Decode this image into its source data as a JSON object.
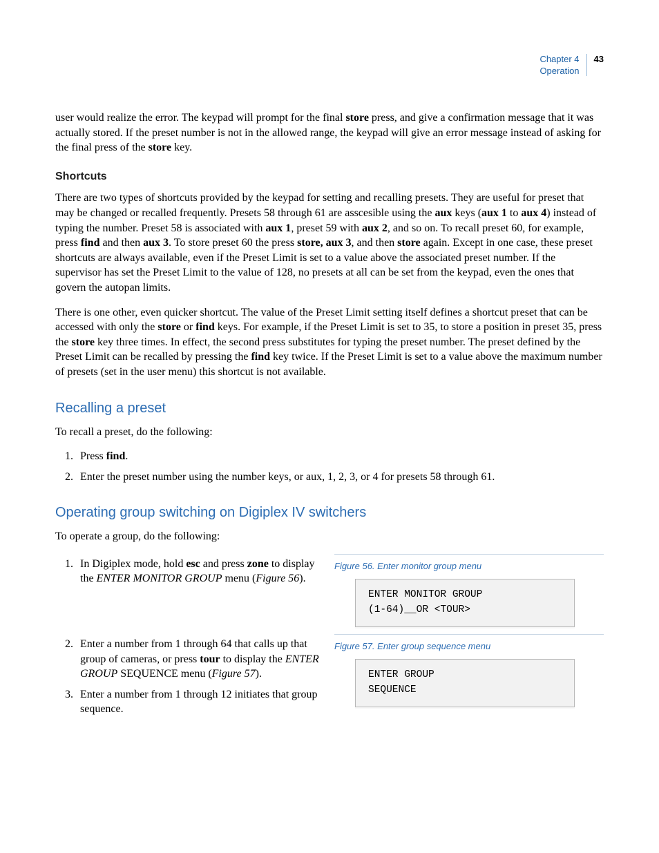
{
  "header": {
    "chapter": "Chapter 4",
    "section": "Operation",
    "page": "43"
  },
  "intro_para": "user would realize the error. The keypad will prompt for the final <b>store</b> press, and give a confirmation message that it was actually stored. If the preset number is not in the allowed range, the keypad will give an error message instead of asking for the final press of the <b>store</b> key.",
  "shortcuts": {
    "heading": "Shortcuts",
    "p1": "There are two types of shortcuts provided by the keypad for setting and recalling presets. They are useful for preset that may be changed or recalled frequently. Presets 58 through 61 are asscesible using the <b>aux</b> keys (<b>aux 1</b> to <b>aux 4</b>) instead of  typing the number. Preset 58 is associated with <b>aux 1</b>, preset 59 with <b>aux 2</b>, and so on. To recall preset 60, for example, press <b>find</b> and then <b>aux 3</b>. To store preset 60 the press <b>store, aux 3</b>, and then <b>store</b> again. Except in one case, these preset shortcuts are always available, even if the Preset Limit is set to a value above the associated preset number. If the supervisor has set the Preset Limit to the value of 128, no presets at all can be set from the keypad, even the ones that govern the autopan limits.",
    "p2": "There is one other, even quicker shortcut. The value of the Preset Limit setting itself defines a shortcut preset that can be accessed with only the <b>store</b> or <b>find</b> keys. For example, if the Preset Limit is set to 35, to store a position in preset 35, press the <b>store</b> key three times. In effect, the second press substitutes for typing the preset number. The preset defined by the Preset Limit can be recalled by pressing the <b>find</b> key twice. If the Preset Limit is set to a value above the maximum number of presets (set in the user menu) this shortcut is not available."
  },
  "recall": {
    "heading": "Recalling a preset",
    "intro": "To recall a preset, do the following:",
    "steps": [
      "Press <b>find</b>.",
      "Enter the preset number using the number keys, or aux, 1, 2, 3, or 4 for presets 58 through 61."
    ]
  },
  "group": {
    "heading": "Operating group switching on Digiplex IV switchers",
    "intro": "To operate a group, do the following:",
    "step1": "In Digiplex mode, hold <b>esc</b> and press <b>zone</b> to display the <i>ENTER MONITOR GROUP</i> menu (<i>Figure 56</i>).",
    "step2": "Enter a number from 1 through 64 that calls up that group of cameras, or press <b>tour</b> to display the <i>ENTER GROUP</i> SEQUENCE menu (<i>Figure 57</i>).",
    "step3": "Enter a number from 1 through 12 initiates that group sequence.",
    "fig56": {
      "caption": "Figure 56. Enter monitor group menu",
      "lcd": "ENTER MONITOR GROUP\n(1-64)__OR <TOUR>"
    },
    "fig57": {
      "caption": "Figure 57. Enter group sequence menu",
      "lcd": "ENTER GROUP\nSEQUENCE"
    }
  }
}
